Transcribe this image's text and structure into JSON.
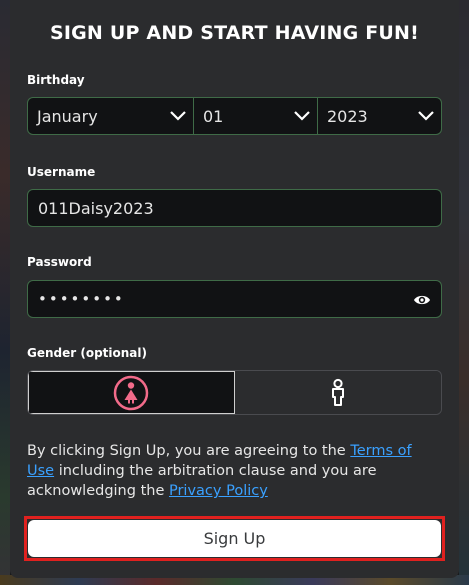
{
  "form": {
    "title": "SIGN UP AND START HAVING FUN!",
    "birthday": {
      "label": "Birthday",
      "month": "January",
      "day": "01",
      "year": "2023"
    },
    "username": {
      "label": "Username",
      "value": "011Daisy2023"
    },
    "password": {
      "label": "Password",
      "masked_value": "••••••••"
    },
    "gender": {
      "label": "Gender (optional)",
      "selected": "female"
    },
    "terms": {
      "prefix": "By clicking Sign Up, you are agreeing to the ",
      "terms_link": "Terms of Use",
      "middle": " including the arbitration clause and you are acknowledging the ",
      "privacy_link": "Privacy Policy"
    },
    "signup_label": "Sign Up"
  },
  "colors": {
    "accent_green": "#3f6b47",
    "link": "#3aa1ff",
    "female_icon": "#f26b8a",
    "highlight": "#e0211f"
  }
}
